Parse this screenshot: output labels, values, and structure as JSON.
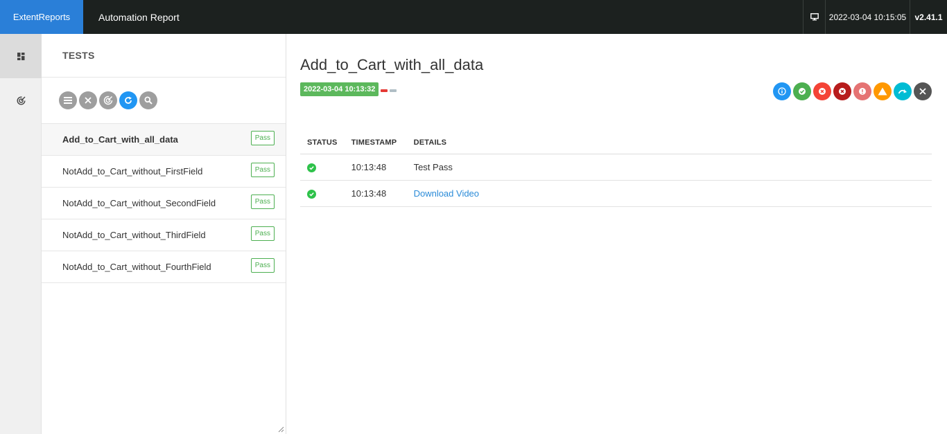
{
  "header": {
    "brand": "ExtentReports",
    "report_name": "Automation Report",
    "datetime": "2022-03-04 10:15:05",
    "version": "v2.41.1"
  },
  "nav": {
    "items": [
      {
        "icon": "dashboard-icon",
        "active": true
      },
      {
        "icon": "analytics-icon",
        "active": false
      }
    ]
  },
  "tests_panel": {
    "title": "TESTS",
    "toolbar_icons": [
      "list-icon",
      "close-icon",
      "radar-icon",
      "refresh-icon",
      "search-icon"
    ],
    "tests": [
      {
        "name": "Add_to_Cart_with_all_data",
        "status": "Pass",
        "active": true
      },
      {
        "name": "NotAdd_to_Cart_without_FirstField",
        "status": "Pass",
        "active": false
      },
      {
        "name": "NotAdd_to_Cart_without_SecondField",
        "status": "Pass",
        "active": false
      },
      {
        "name": "NotAdd_to_Cart_without_ThirdField",
        "status": "Pass",
        "active": false
      },
      {
        "name": "NotAdd_to_Cart_without_FourthField",
        "status": "Pass",
        "active": false
      }
    ]
  },
  "detail": {
    "test_name": "Add_to_Cart_with_all_data",
    "start_time": "2022-03-04 10:13:32",
    "filter_colors": {
      "info": "#2196f3",
      "pass": "#4caf50",
      "fail": "#f44336",
      "fatal": "#b71c1c",
      "error": "#e57373",
      "warning": "#ff9800",
      "skip": "#00bcd4",
      "clear": "#555555"
    },
    "columns": [
      "STATUS",
      "TIMESTAMP",
      "DETAILS"
    ],
    "logs": [
      {
        "status": "pass",
        "timestamp": "10:13:48",
        "details": "Test Pass",
        "is_link": false
      },
      {
        "status": "pass",
        "timestamp": "10:13:48",
        "details": "Download Video",
        "is_link": true
      }
    ]
  }
}
